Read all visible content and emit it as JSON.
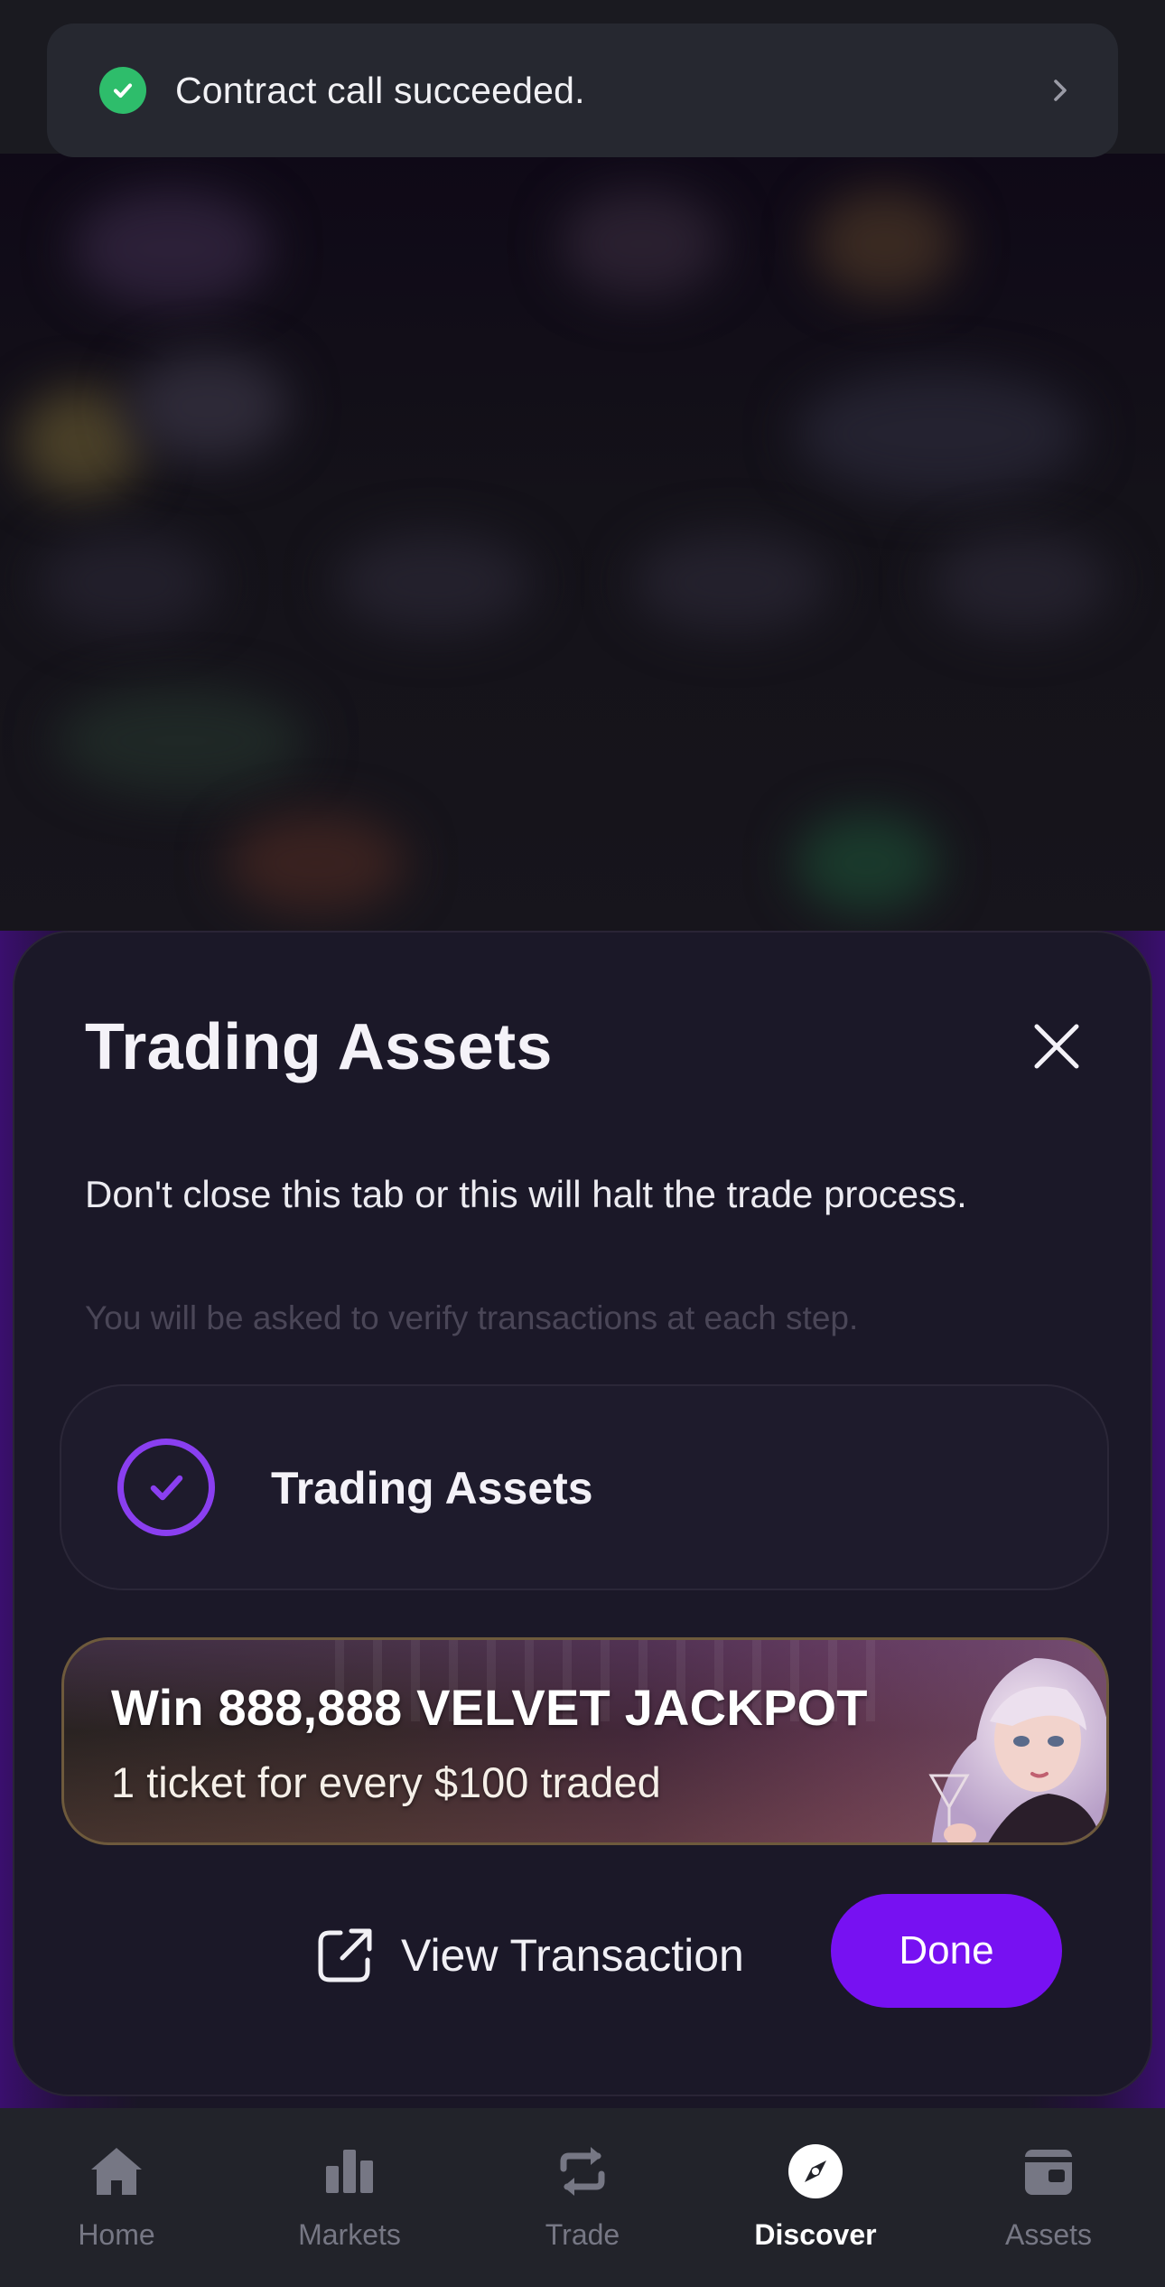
{
  "toast": {
    "message": "Contract call succeeded."
  },
  "modal": {
    "title": "Trading Assets",
    "warning": "Don't close this tab or this will halt the trade process.",
    "hint": "You will be asked to verify transactions at each step.",
    "step": {
      "label": "Trading Assets",
      "status": "completed"
    },
    "banner": {
      "title": "Win 888,888 VELVET JACKPOT",
      "subtitle": "1 ticket for every $100 traded"
    },
    "view_transaction_label": "View Transaction",
    "done_label": "Done"
  },
  "nav": {
    "items": [
      {
        "label": "Home",
        "icon": "home-icon"
      },
      {
        "label": "Markets",
        "icon": "markets-icon"
      },
      {
        "label": "Trade",
        "icon": "trade-icon"
      },
      {
        "label": "Discover",
        "icon": "discover-icon",
        "active": true
      },
      {
        "label": "Assets",
        "icon": "wallet-icon"
      }
    ]
  },
  "colors": {
    "accent": "#7711f2",
    "success": "#2ebd6b",
    "sheet": "#1b1828"
  }
}
